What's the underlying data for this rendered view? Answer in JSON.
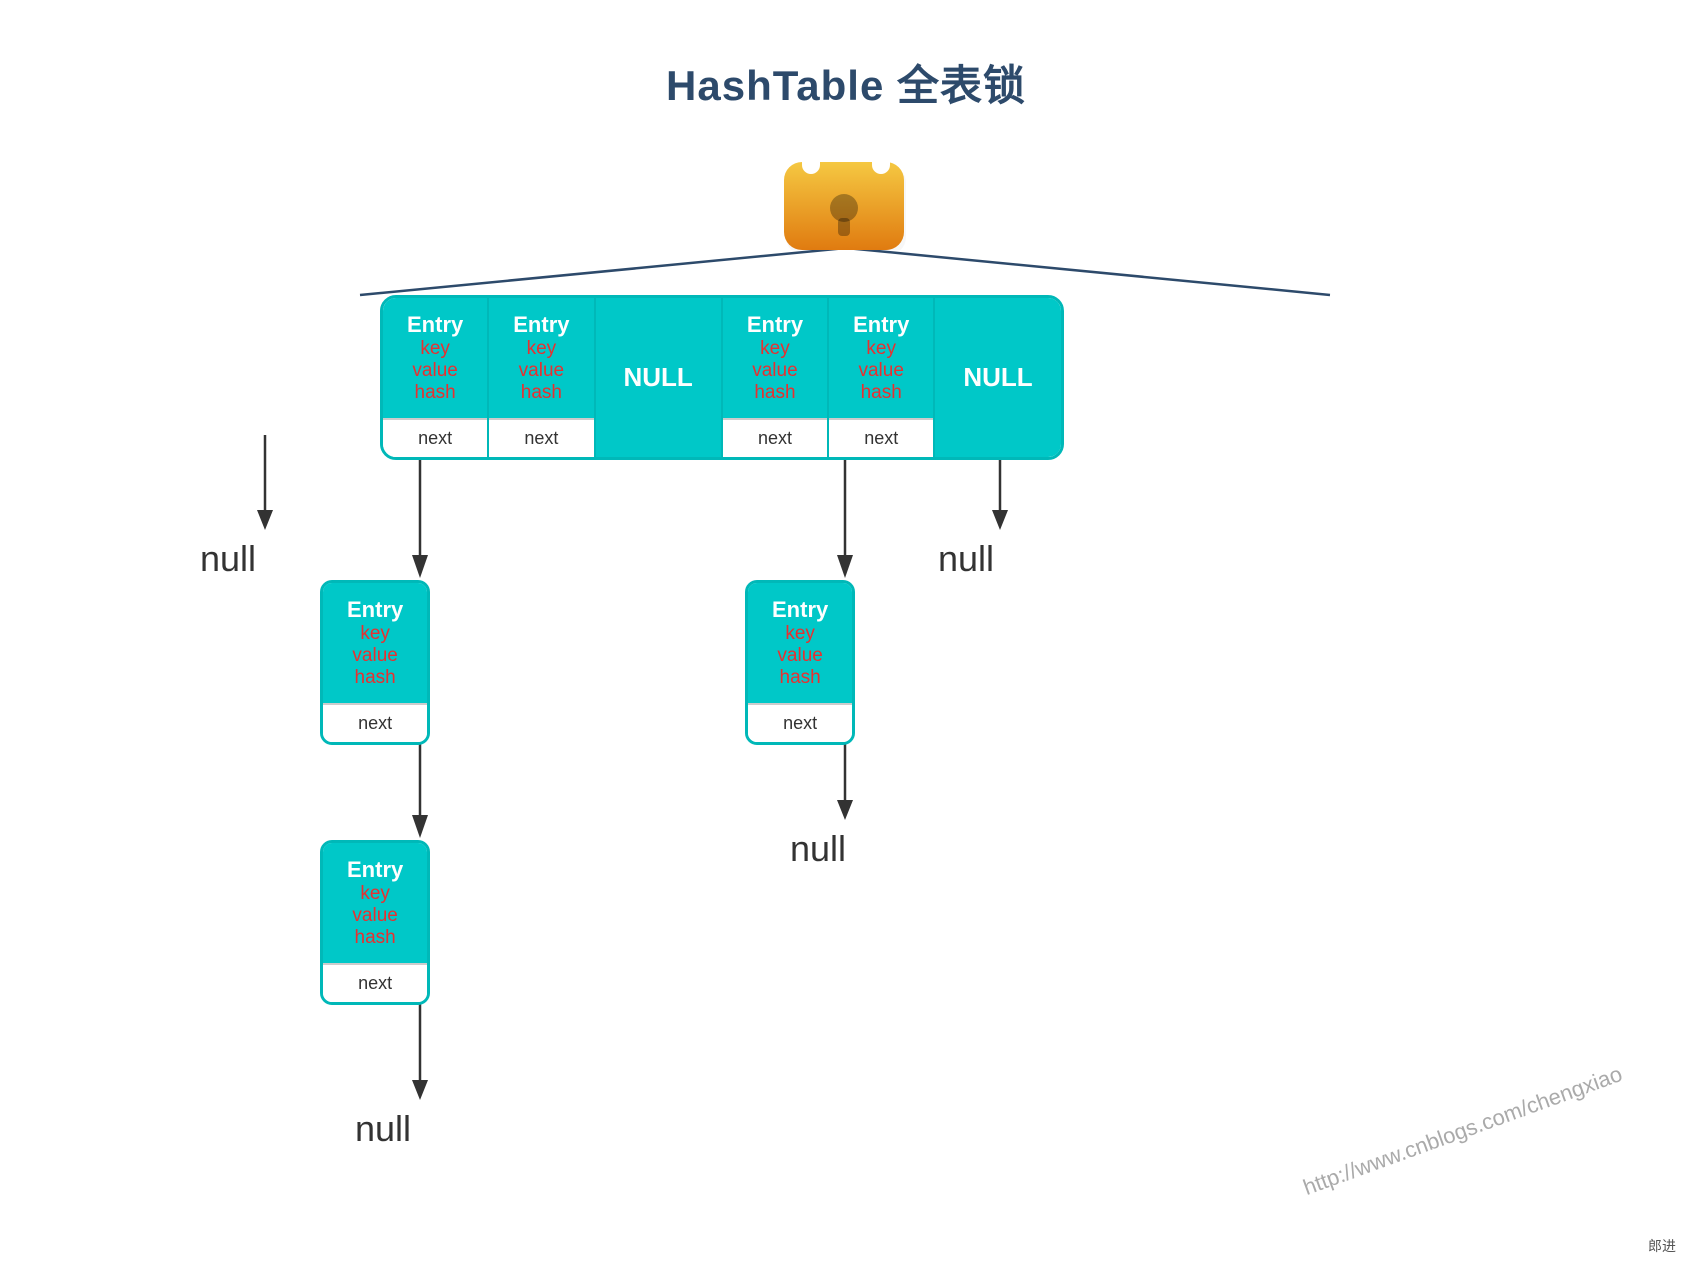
{
  "title": "HashTable 全表锁",
  "top_row": {
    "cells": [
      {
        "type": "entry",
        "label": "Entry",
        "key": "key",
        "value": "value",
        "hash": "hash",
        "next": "next"
      },
      {
        "type": "entry",
        "label": "Entry",
        "key": "key",
        "value": "value",
        "hash": "hash",
        "next": "next"
      },
      {
        "type": "null",
        "label": "NULL"
      },
      {
        "type": "entry",
        "label": "Entry",
        "key": "key",
        "value": "value",
        "hash": "hash",
        "next": "next"
      },
      {
        "type": "entry",
        "label": "Entry",
        "key": "key",
        "value": "value",
        "hash": "hash",
        "next": "next"
      },
      {
        "type": "null",
        "label": "NULL"
      }
    ]
  },
  "chain1": {
    "null_label": "null",
    "entry2": {
      "label": "Entry",
      "key": "key",
      "value": "value",
      "hash": "hash",
      "next": "next"
    },
    "entry3": {
      "label": "Entry",
      "key": "key",
      "value": "value",
      "hash": "hash",
      "next": "next"
    },
    "null_bottom": "null"
  },
  "chain2": {
    "entry2": {
      "label": "Entry",
      "key": "key",
      "value": "value",
      "hash": "hash",
      "next": "next"
    },
    "null_bottom": "null"
  },
  "chain3": {
    "null_label": "null"
  },
  "watermark": "http://www.cnblogs.com/chengxiao",
  "footer": "郎进"
}
